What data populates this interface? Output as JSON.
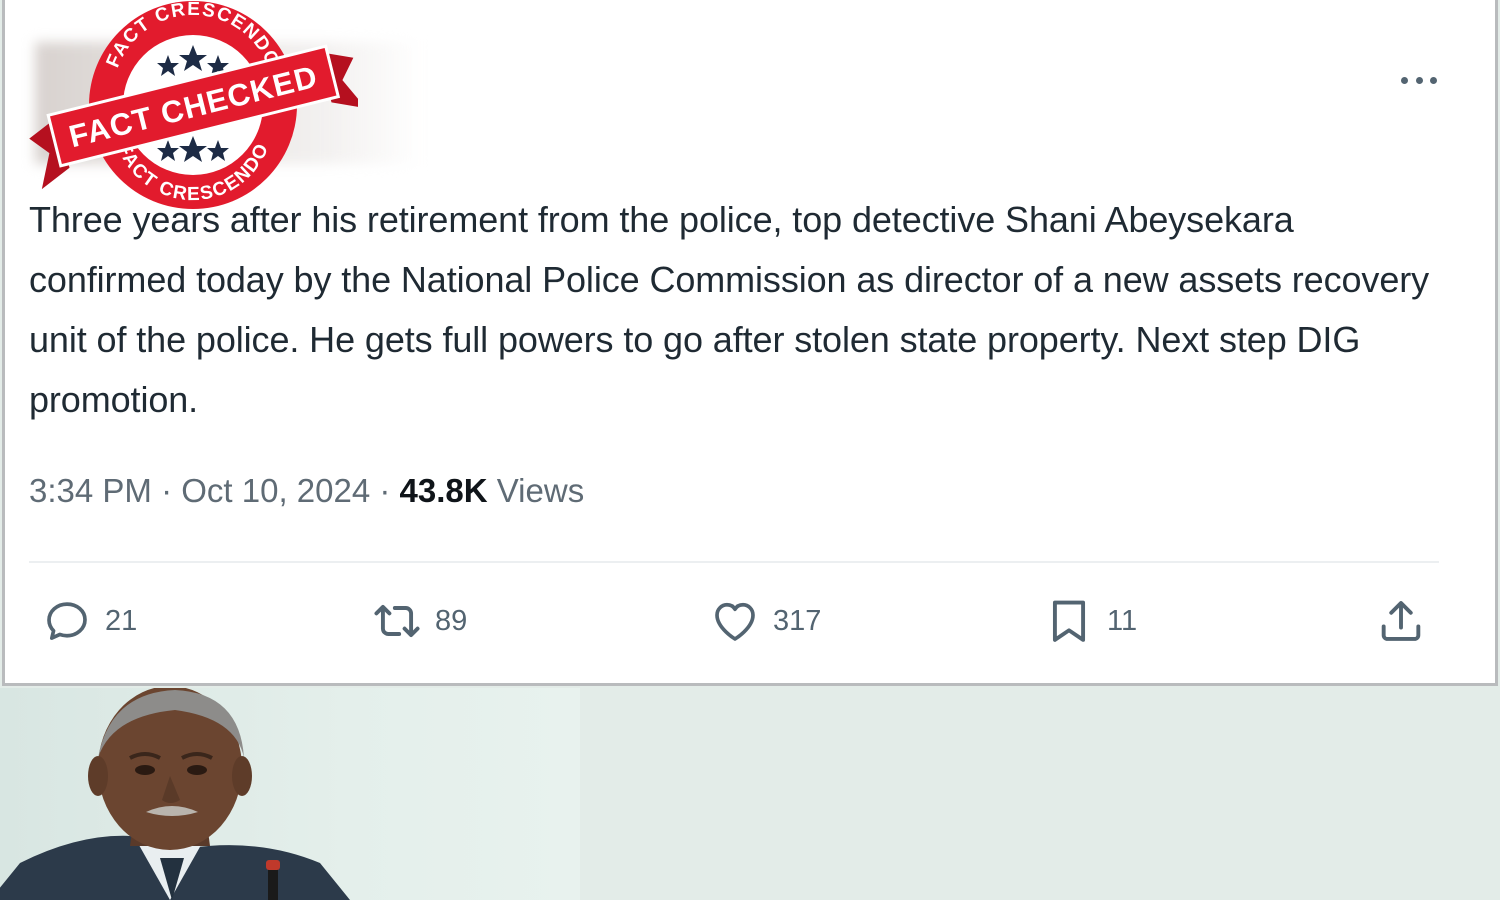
{
  "tweet": {
    "text": "Three years after his retirement from the police, top detective Shani Abeysekara confirmed today by the National Police Commission as director of a new assets recovery unit of the police. He gets full powers to go after stolen state property. Next step DIG promotion.",
    "time": "3:34 PM",
    "separator": " · ",
    "date": "Oct 10, 2024",
    "views_count": "43.8K",
    "views_label": "Views",
    "more_icon": "more-horizontal-icon"
  },
  "actions": {
    "replies": "21",
    "retweets": "89",
    "likes": "317",
    "bookmarks": "11"
  },
  "stamp": {
    "top_text": "FACT CRESCENDO",
    "ribbon_text": "FACT CHECKED",
    "bottom_text": "FACT CRESCENDO",
    "color": "#e21b2d"
  },
  "colors": {
    "text": "#1f2a33",
    "muted": "#536471",
    "background": "#e3ece8"
  }
}
